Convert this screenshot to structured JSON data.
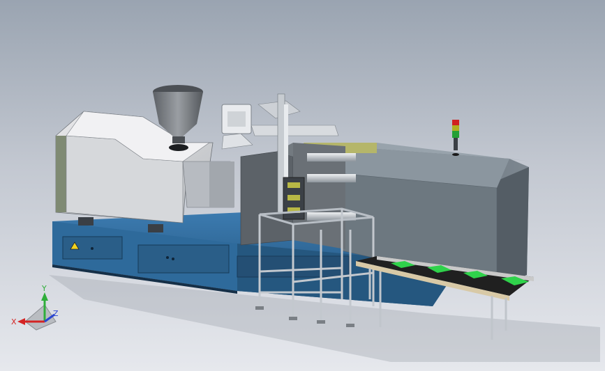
{
  "viewport": {
    "background_top": "#9aa4b1",
    "background_bottom": "#e6e8ed"
  },
  "model": {
    "machine_body_color": "#8f9aa3",
    "base_color": "#2f6c9e",
    "hopper_color": "#7b8085",
    "conveyor_belt_color": "#1f1f1f",
    "conveyor_cleat_color": "#2fd24b",
    "signal_tower_colors": [
      "#d02020",
      "#b0b020",
      "#25a035"
    ]
  },
  "triad": {
    "x_label": "X",
    "y_label": "Y",
    "z_label": "Z",
    "x_color": "#d42424",
    "y_color": "#2fae3a",
    "z_color": "#2b46d0"
  }
}
